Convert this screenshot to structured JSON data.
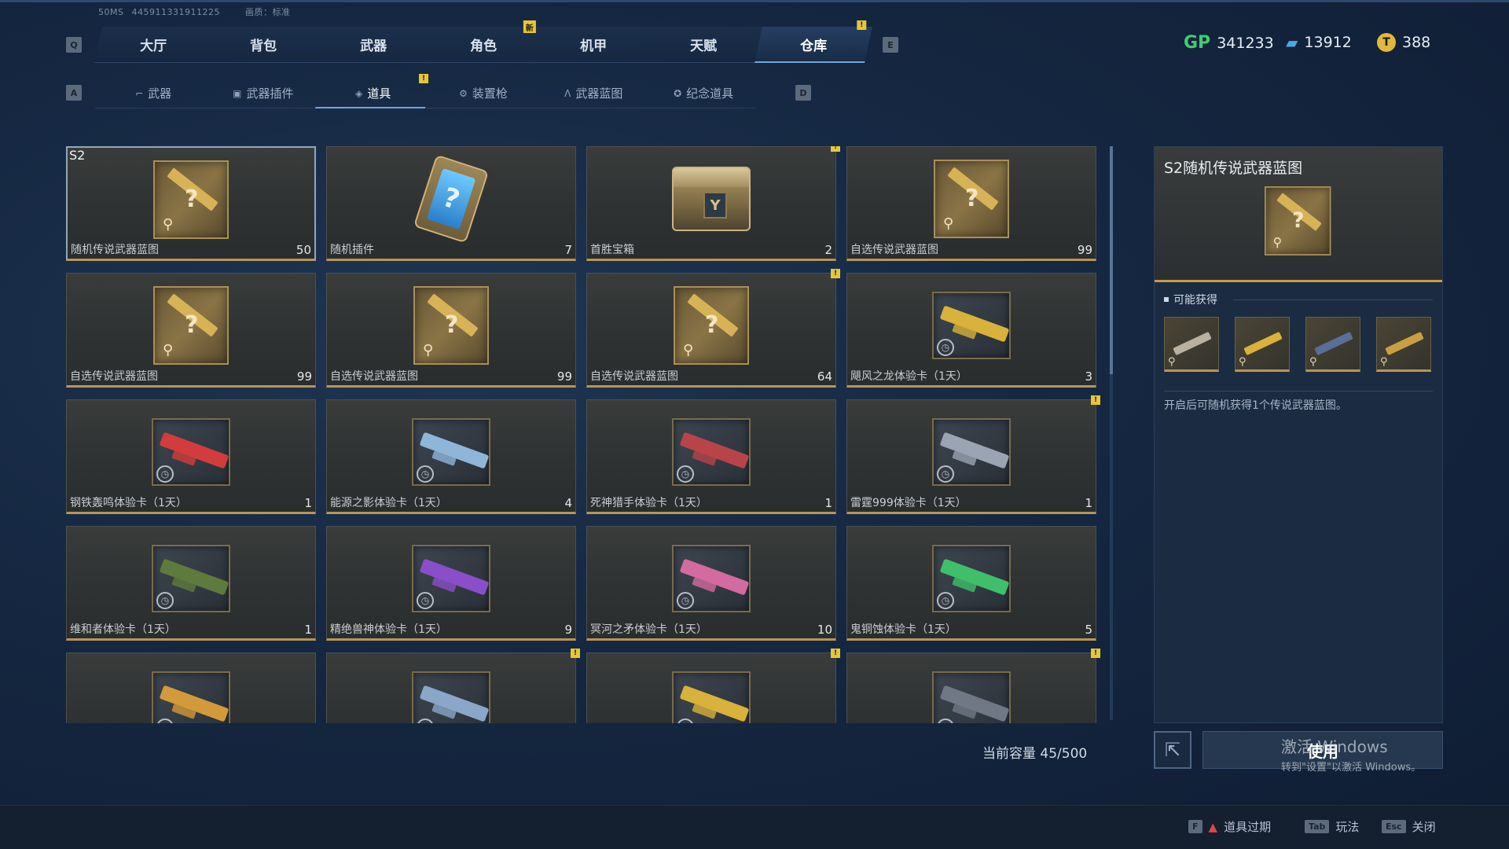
{
  "hud": {
    "ms": "50MS",
    "uid": "445911331911225",
    "quality": "画质：标准"
  },
  "keys": {
    "prev_main": "Q",
    "next_main": "E",
    "prev_sub": "A",
    "next_sub": "D"
  },
  "main_tabs": [
    {
      "label": "大厅"
    },
    {
      "label": "背包"
    },
    {
      "label": "武器"
    },
    {
      "label": "角色",
      "badge": "新"
    },
    {
      "label": "机甲"
    },
    {
      "label": "天赋"
    },
    {
      "label": "仓库",
      "badge": "!"
    }
  ],
  "currency": [
    {
      "icon": "GP",
      "value": "341233",
      "color": "#3fcf6f"
    },
    {
      "icon": "ticket",
      "value": "13912",
      "color": "#4aa8e8"
    },
    {
      "icon": "coin",
      "value": "388",
      "color": "#e0b83a"
    }
  ],
  "sub_tabs": [
    {
      "label": "武器",
      "icon": "gun-icon"
    },
    {
      "label": "武器插件",
      "icon": "chip-icon"
    },
    {
      "label": "道具",
      "icon": "tag-icon",
      "badge": "!"
    },
    {
      "label": "装置枪",
      "icon": "device-icon"
    },
    {
      "label": "武器蓝图",
      "icon": "blueprint-icon"
    },
    {
      "label": "纪念道具",
      "icon": "medal-icon"
    }
  ],
  "items": [
    {
      "name": "随机传说武器蓝图",
      "count": "50",
      "kind": "blueprint",
      "tag": "S2",
      "selected": true
    },
    {
      "name": "随机插件",
      "count": "7",
      "kind": "card"
    },
    {
      "name": "首胜宝箱",
      "count": "2",
      "kind": "box",
      "badge": "!"
    },
    {
      "name": "自选传说武器蓝图",
      "count": "99",
      "kind": "blueprint"
    },
    {
      "name": "自选传说武器蓝图",
      "count": "99",
      "kind": "blueprint"
    },
    {
      "name": "自选传说武器蓝图",
      "count": "99",
      "kind": "blueprint"
    },
    {
      "name": "自选传说武器蓝图",
      "count": "64",
      "kind": "blueprint",
      "badge": "!"
    },
    {
      "name": "飓风之龙体验卡（1天）",
      "count": "3",
      "kind": "trial",
      "color": "#d8b23a"
    },
    {
      "name": "钢铁轰鸣体验卡（1天）",
      "count": "1",
      "kind": "trial",
      "color": "#d23c3c"
    },
    {
      "name": "能源之影体验卡（1天）",
      "count": "4",
      "kind": "trial",
      "color": "#8fb6d8"
    },
    {
      "name": "死神猎手体验卡（1天）",
      "count": "1",
      "kind": "trial",
      "color": "#b8444a"
    },
    {
      "name": "雷霆999体验卡（1天）",
      "count": "1",
      "kind": "trial",
      "color": "#9aa4b2",
      "badge": "!"
    },
    {
      "name": "维和者体验卡（1天）",
      "count": "1",
      "kind": "trial",
      "color": "#5e7a3c"
    },
    {
      "name": "精绝兽神体验卡（1天）",
      "count": "9",
      "kind": "trial",
      "color": "#8a4ec8"
    },
    {
      "name": "冥河之矛体验卡（1天）",
      "count": "10",
      "kind": "trial",
      "color": "#d36aa0"
    },
    {
      "name": "鬼铜蚀体验卡（1天）",
      "count": "5",
      "kind": "trial",
      "color": "#3fbf6a"
    },
    {
      "name": "",
      "count": "",
      "kind": "trial",
      "color": "#d29a3a"
    },
    {
      "name": "",
      "count": "",
      "kind": "trial",
      "color": "#8aa6c8",
      "badge": "!"
    },
    {
      "name": "",
      "count": "",
      "kind": "trial",
      "color": "#d8b23a",
      "badge": "!"
    },
    {
      "name": "",
      "count": "",
      "kind": "trial",
      "color": "#6f7884",
      "badge": "!"
    }
  ],
  "capacity": "当前容量 45/500",
  "detail": {
    "title": "S2随机传说武器蓝图",
    "section_title": "可能获得",
    "rewards": [
      {
        "color": "#b8b0a0"
      },
      {
        "color": "#d8b23a"
      },
      {
        "color": "#5a6e9a"
      },
      {
        "color": "#c8a040"
      }
    ],
    "description": "开启后可随机获得1个传说武器蓝图。"
  },
  "use_button": "使用",
  "watermark": {
    "line1": "激活 Windows",
    "line2": "转到\"设置\"以激活 Windows。"
  },
  "hints": [
    {
      "key": "F",
      "label": "道具过期",
      "warn": true
    },
    {
      "key": "Tab",
      "label": "玩法"
    },
    {
      "key": "Esc",
      "label": "关闭"
    }
  ]
}
